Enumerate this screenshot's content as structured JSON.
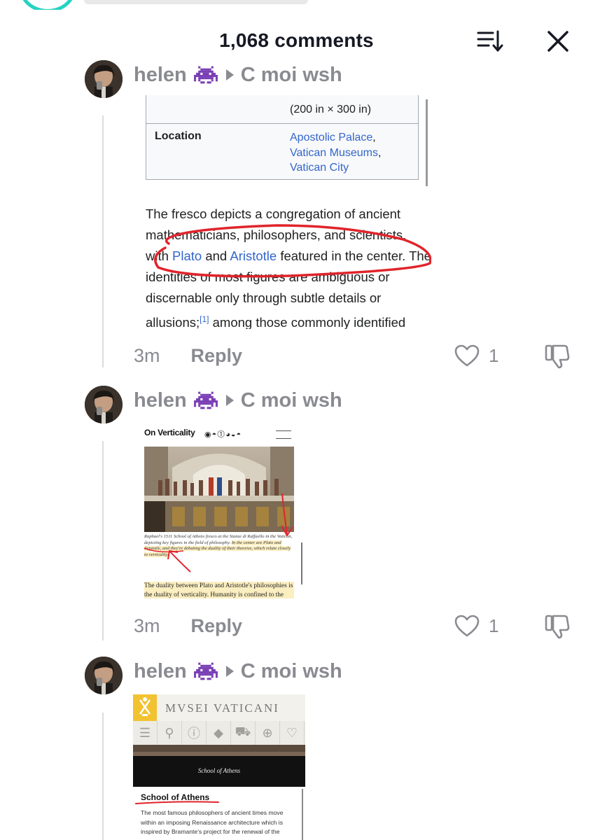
{
  "header": {
    "title": "1,068 comments"
  },
  "comments": [
    {
      "username": "helen",
      "reply_to": "C moi wsh",
      "time": "3m",
      "reply_label": "Reply",
      "likes": "1",
      "screenshot": {
        "dimensions": "(200 in × 300 in)",
        "location_label": "Location",
        "location_1": "Apostolic Palace",
        "location_2": "Vatican Museums",
        "location_3": "Vatican City",
        "text_1": "The fresco depicts a congregation of ancient mathematicians, philosophers, and scientists, with ",
        "link_plato": "Plato",
        "text_and": " and ",
        "link_aristotle": "Aristotle",
        "text_2": " featured in the center. The identities of most figures are ambiguous or discernable only through subtle details or allusions;",
        "ref": "[1]",
        "text_3": " among those commonly identified"
      }
    },
    {
      "username": "helen",
      "reply_to": "C moi wsh",
      "time": "3m",
      "reply_label": "Reply",
      "likes": "1",
      "screenshot": {
        "title": "On Verticality",
        "icons": "◉◓⓵◕◒◓",
        "caption_plain": "Raphael's 1511 School of Athens fresco at the Stanze di Raffaello in the Vatican, depicting key figures in the field of philosophy. ",
        "caption_highlight": "In the center are Plato and Aristotle, and they're debating the duality of their theories, which relate closely to verticality.",
        "body": "The duality between Plato and Aristotle's philosophies is the duality of verticality. Humanity is confined to the"
      }
    },
    {
      "username": "helen",
      "reply_to": "C moi wsh",
      "screenshot": {
        "site_title": "MVSEI VATICANI",
        "banner_text": "School of Athens",
        "heading": "School of Athens",
        "body": "The most famous philosophers of ancient times move within an imposing Renaissance architecture which is inspired by Bramante's project for the renewal of the"
      }
    }
  ],
  "colors": {
    "muted_text": "#8a8b91",
    "link": "#3366cc",
    "annotation_red": "#e0242b",
    "highlight": "#fbeec0",
    "vatican_yellow": "#f2c230"
  }
}
